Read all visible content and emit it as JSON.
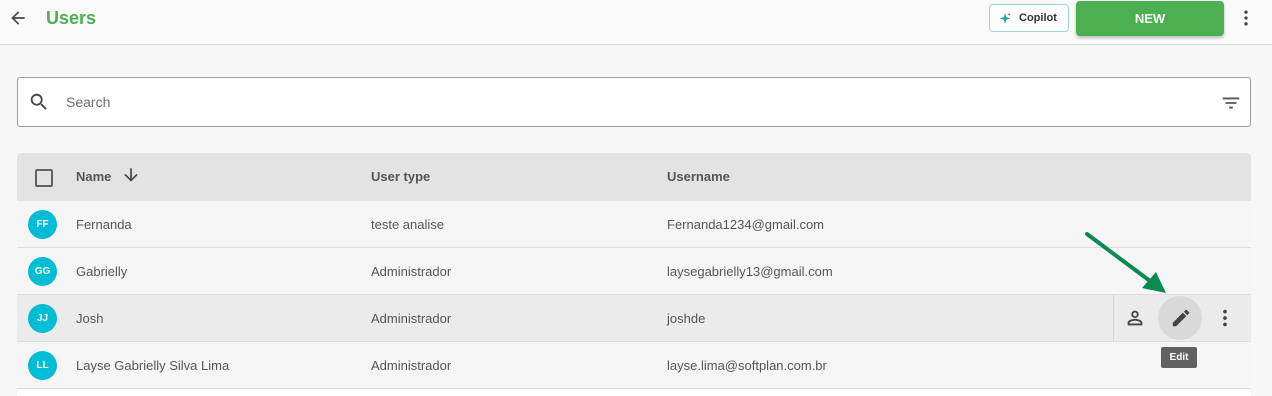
{
  "header": {
    "title": "Users",
    "copilot_label": "Copilot",
    "new_label": "NEW"
  },
  "search": {
    "placeholder": "Search"
  },
  "table": {
    "columns": [
      "Name",
      "User type",
      "Username"
    ],
    "rows": [
      {
        "initials": "FF",
        "name": "Fernanda",
        "user_type": "teste analise",
        "username": "Fernanda1234@gmail.com"
      },
      {
        "initials": "GG",
        "name": "Gabrielly",
        "user_type": "Administrador",
        "username": "laysegabrielly13@gmail.com"
      },
      {
        "initials": "JJ",
        "name": "Josh",
        "user_type": "Administrador",
        "username": "joshde"
      },
      {
        "initials": "LL",
        "name": "Layse Gabrielly Silva Lima",
        "user_type": "Administrador",
        "username": "layse.lima@softplan.com.br"
      }
    ]
  },
  "tooltip": {
    "edit": "Edit"
  },
  "colors": {
    "accent": "#4caf50",
    "avatar": "#00bcd4",
    "annotation_arrow": "#0b8a50"
  },
  "icons": [
    "arrow-left-icon",
    "sparkle-icon",
    "more-vert-icon",
    "search-icon",
    "filter-icon",
    "arrow-down-icon",
    "person-icon",
    "pencil-icon"
  ]
}
